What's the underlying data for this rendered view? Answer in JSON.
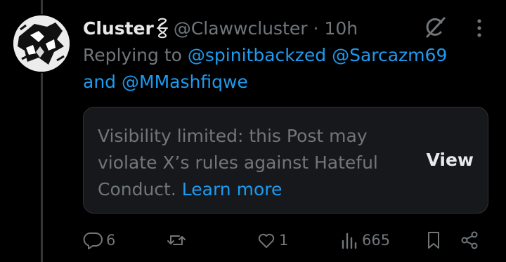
{
  "post": {
    "display_name": "Cluster",
    "handle": "@Clawwcluster",
    "separator": "·",
    "time": "10h"
  },
  "reply": {
    "prefix": "Replying to",
    "mentions": [
      "@spinitbackzed",
      "@Sarcazm69",
      "@MMashfiqwe"
    ],
    "conjunction": "and"
  },
  "notice": {
    "text": "Visibility limited: this Post may violate X’s rules against Hateful Conduct.",
    "learn_more": "Learn more",
    "view_label": "View"
  },
  "actions": {
    "replies": "6",
    "reposts": "",
    "likes": "1",
    "views": "665"
  },
  "colors": {
    "background": "#000000",
    "text_primary": "#e7e9ea",
    "text_secondary": "#71767b",
    "accent": "#1d9bf0",
    "card_background": "#16181c",
    "border": "#2f3336"
  },
  "icons": [
    "name-symbol-icon",
    "grok-icon",
    "more-icon",
    "reply-icon",
    "repost-icon",
    "like-icon",
    "views-icon",
    "bookmark-icon",
    "share-icon"
  ]
}
